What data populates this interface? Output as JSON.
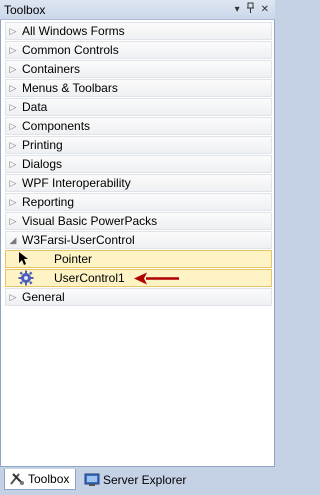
{
  "titlebar": {
    "title": "Toolbox",
    "dropdown_glyph": "▾",
    "pin_glyph": "ᵽ",
    "close_glyph": "✕"
  },
  "categories_top": [
    {
      "label": "All Windows Forms",
      "expanded": false
    },
    {
      "label": "Common Controls",
      "expanded": false
    },
    {
      "label": "Containers",
      "expanded": false
    },
    {
      "label": "Menus & Toolbars",
      "expanded": false
    },
    {
      "label": "Data",
      "expanded": false
    },
    {
      "label": "Components",
      "expanded": false
    },
    {
      "label": "Printing",
      "expanded": false
    },
    {
      "label": "Dialogs",
      "expanded": false
    },
    {
      "label": "WPF Interoperability",
      "expanded": false
    },
    {
      "label": "Reporting",
      "expanded": false
    },
    {
      "label": "Visual Basic PowerPacks",
      "expanded": false
    }
  ],
  "expanded_category": {
    "label": "W3Farsi-UserControl",
    "items": [
      {
        "label": "Pointer",
        "icon": "pointer-arrow-icon"
      },
      {
        "label": "UserControl1",
        "icon": "gear-icon"
      }
    ]
  },
  "categories_bottom": [
    {
      "label": "General",
      "expanded": false
    }
  ],
  "tabs": [
    {
      "label": "Toolbox",
      "icon": "toolbox-icon",
      "active": true
    },
    {
      "label": "Server Explorer",
      "icon": "server-explorer-icon",
      "active": false
    }
  ],
  "colors": {
    "item_highlight": "#fdf3c4",
    "item_border": "#e7c566",
    "annotation_arrow": "#b00000",
    "chrome": "#c5d2e6"
  }
}
